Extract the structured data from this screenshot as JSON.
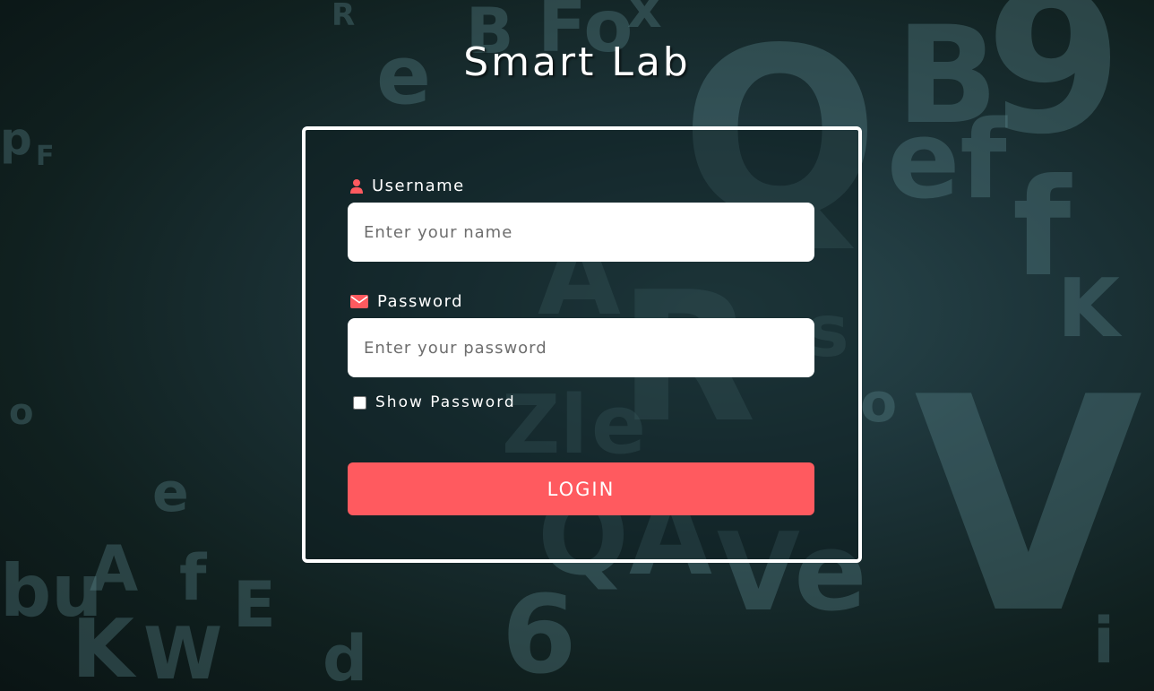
{
  "page": {
    "title": "Smart Lab"
  },
  "form": {
    "username": {
      "label": "Username",
      "placeholder": "Enter your name",
      "value": ""
    },
    "password": {
      "label": "Password",
      "placeholder": "Enter your password",
      "value": ""
    },
    "show_password": {
      "label": "Show Password",
      "checked": false
    },
    "login_button": {
      "label": "LOGIN"
    }
  },
  "colors": {
    "accent": "#ff5a5f",
    "text": "#ffffff",
    "input_bg": "#ffffff",
    "border": "#ffffff"
  },
  "icons": {
    "username": "user-icon",
    "password": "envelope-icon"
  }
}
